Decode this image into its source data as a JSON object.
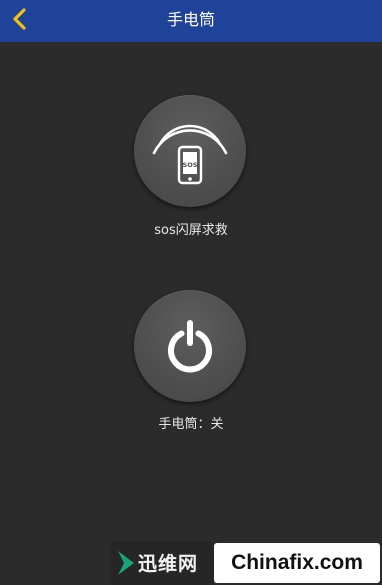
{
  "header": {
    "title": "手电筒",
    "back_icon": "chevron-left-icon",
    "background": "#20439a",
    "icon_color": "#f4c20d"
  },
  "sos": {
    "label": "sos闪屏求救",
    "icon": "phone-signal-icon",
    "icon_text": "SOS"
  },
  "flashlight": {
    "label": "手电筒：关",
    "icon": "power-icon"
  },
  "watermark": {
    "brand": "迅维网",
    "domain": "Chinafix.com",
    "arrow_color": "#1aa37a"
  }
}
